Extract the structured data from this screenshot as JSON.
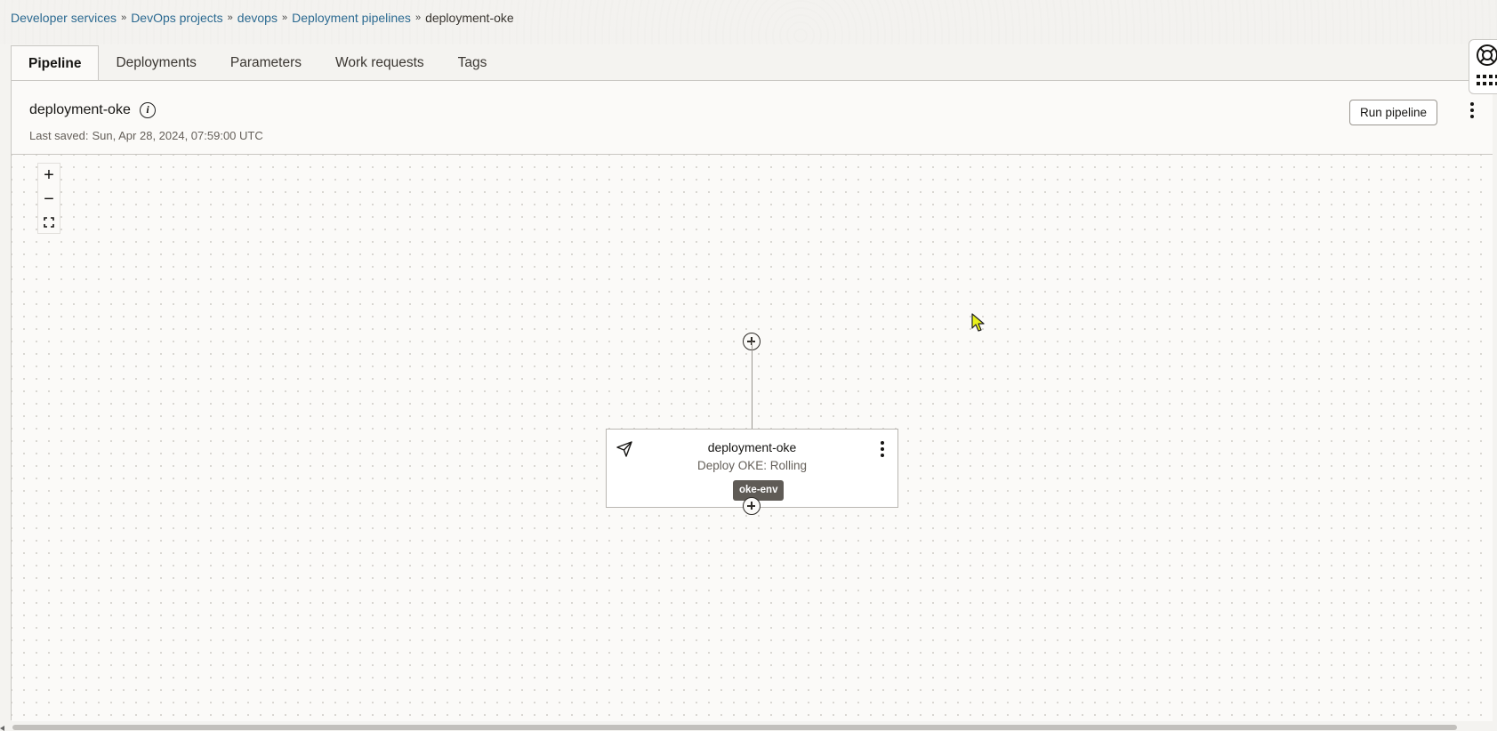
{
  "breadcrumb": {
    "items": [
      "Developer services",
      "DevOps projects",
      "devops",
      "Deployment pipelines"
    ],
    "current": "deployment-oke"
  },
  "tabs": [
    "Pipeline",
    "Deployments",
    "Parameters",
    "Work requests",
    "Tags"
  ],
  "active_tab": "Pipeline",
  "header": {
    "title": "deployment-oke",
    "last_saved_label": "Last saved:",
    "last_saved_value": "Sun, Apr 28, 2024, 07:59:00 UTC",
    "run_button": "Run pipeline"
  },
  "zoom": {
    "in": "+",
    "out": "−"
  },
  "stage": {
    "name": "deployment-oke",
    "type": "Deploy OKE: Rolling",
    "environment": "oke-env"
  },
  "colors": {
    "link": "#2c6a91",
    "badge_bg": "#5f5b56",
    "cursor": "#e8f01a"
  },
  "icons": [
    "info-icon",
    "more-vertical-icon",
    "zoom-in-icon",
    "zoom-out-icon",
    "fit-screen-icon",
    "add-stage-icon",
    "deploy-send-icon",
    "help-lifebuoy-icon",
    "apps-grid-icon"
  ]
}
